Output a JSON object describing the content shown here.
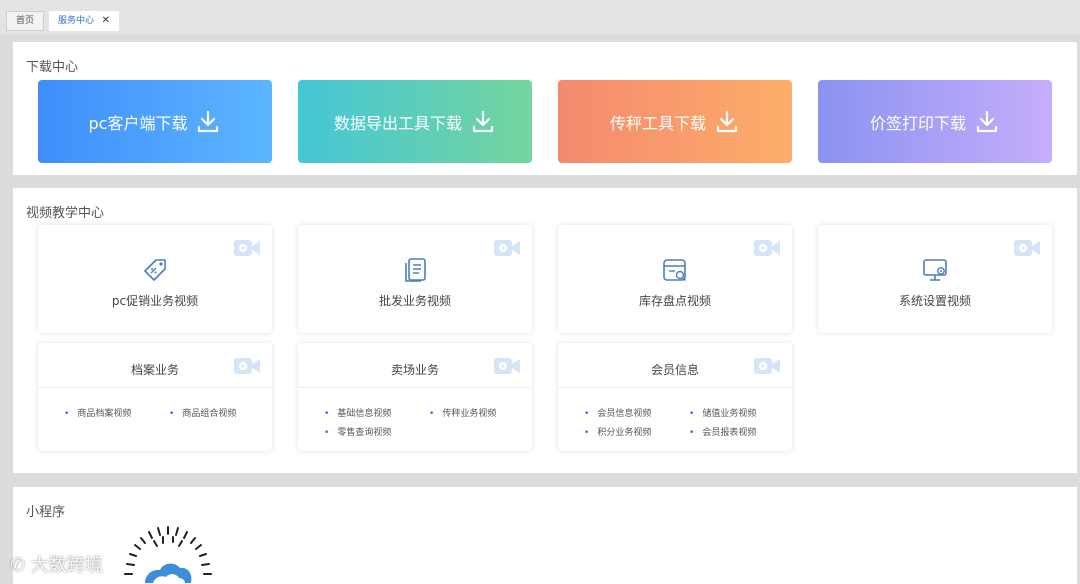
{
  "tabs": [
    {
      "label": "首页"
    },
    {
      "label": "服务中心",
      "close": "✕"
    }
  ],
  "download": {
    "title": "下载中心",
    "items": [
      {
        "label": "pc客户端下载",
        "from": "#3f8efc",
        "to": "#5cb6fe"
      },
      {
        "label": "数据导出工具下载",
        "from": "#45c6d6",
        "to": "#74d59e"
      },
      {
        "label": "传秤工具下载",
        "from": "#f4896f",
        "to": "#fdae6a"
      },
      {
        "label": "价签打印下载",
        "from": "#8b92f0",
        "to": "#c6aefc"
      }
    ]
  },
  "video": {
    "title": "视频教学中心",
    "cards": [
      {
        "label": "pc促销业务视频",
        "icon": "tag-icon"
      },
      {
        "label": "批发业务视频",
        "icon": "document-icon"
      },
      {
        "label": "库存盘点视频",
        "icon": "inventory-icon"
      },
      {
        "label": "系统设置视频",
        "icon": "monitor-settings-icon"
      }
    ],
    "groups": [
      {
        "title": "档案业务",
        "links": [
          "商品档案视频",
          "商品组合视频"
        ]
      },
      {
        "title": "卖场业务",
        "links": [
          "基础信息视频",
          "传秤业务视频",
          "零售查询视频"
        ]
      },
      {
        "title": "会员信息",
        "links": [
          "会员信息视频",
          "储值业务视频",
          "积分业务视频",
          "会员报表视频"
        ]
      }
    ]
  },
  "miniprogram": {
    "title": "小程序"
  },
  "colors": {
    "accent": "#2e6fd8",
    "icon": "#4a7cc4",
    "camera": "#d5e4f6"
  }
}
